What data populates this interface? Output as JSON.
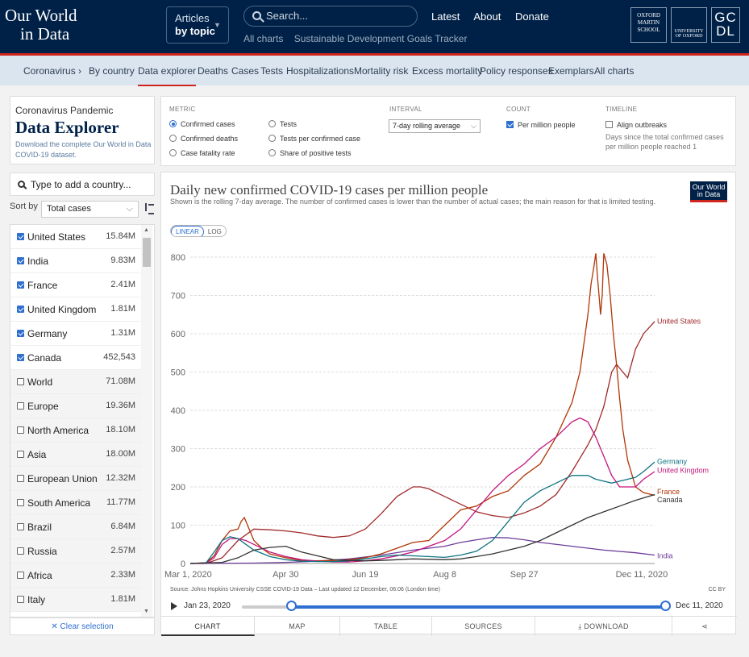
{
  "logo": {
    "line1": "Our World",
    "line2": "in Data"
  },
  "articles": {
    "line1": "Articles",
    "line2": "by topic"
  },
  "search": {
    "placeholder": "Search..."
  },
  "sublinks": [
    "All charts",
    "Sustainable Development Goals Tracker"
  ],
  "mainnav": [
    "Latest",
    "About",
    "Donate"
  ],
  "partners": {
    "oxford_martin": [
      "OXFORD",
      "MARTIN",
      "SCHOOL"
    ],
    "oxford": "UNIVERSITY OF OXFORD",
    "gcdl": [
      "GC",
      "DL"
    ]
  },
  "subnav": [
    "Coronavirus ›",
    "By country",
    "Data explorer",
    "Deaths",
    "Cases",
    "Tests",
    "Hospitalizations",
    "Mortality risk",
    "Excess mortality",
    "Policy responses",
    "Exemplars",
    "All charts"
  ],
  "explorer": {
    "kicker": "Coronavirus Pandemic",
    "title": "Data Explorer",
    "desc": "Download the complete Our World in Data COVID-19 dataset."
  },
  "add_country": "Type to add a country...",
  "sort": {
    "label": "Sort by",
    "value": "Total cases"
  },
  "countries": [
    {
      "name": "United States",
      "value": "15.84M",
      "checked": true
    },
    {
      "name": "India",
      "value": "9.83M",
      "checked": true
    },
    {
      "name": "France",
      "value": "2.41M",
      "checked": true
    },
    {
      "name": "United Kingdom",
      "value": "1.81M",
      "checked": true
    },
    {
      "name": "Germany",
      "value": "1.31M",
      "checked": true
    },
    {
      "name": "Canada",
      "value": "452,543",
      "checked": true
    },
    {
      "name": "World",
      "value": "71.08M",
      "checked": false
    },
    {
      "name": "Europe",
      "value": "19.36M",
      "checked": false
    },
    {
      "name": "North America",
      "value": "18.10M",
      "checked": false
    },
    {
      "name": "Asia",
      "value": "18.00M",
      "checked": false
    },
    {
      "name": "European Union",
      "value": "12.32M",
      "checked": false
    },
    {
      "name": "South America",
      "value": "11.77M",
      "checked": false
    },
    {
      "name": "Brazil",
      "value": "6.84M",
      "checked": false
    },
    {
      "name": "Russia",
      "value": "2.57M",
      "checked": false
    },
    {
      "name": "Africa",
      "value": "2.33M",
      "checked": false
    },
    {
      "name": "Italy",
      "value": "1.81M",
      "checked": false
    }
  ],
  "clear_selection": "✕ Clear selection",
  "controls": {
    "metric_label": "METRIC",
    "metrics": [
      {
        "label": "Confirmed cases",
        "selected": true
      },
      {
        "label": "Confirmed deaths",
        "selected": false
      },
      {
        "label": "Case fatality rate",
        "selected": false
      },
      {
        "label": "Tests",
        "selected": false
      },
      {
        "label": "Tests per confirmed case",
        "selected": false
      },
      {
        "label": "Share of positive tests",
        "selected": false
      }
    ],
    "interval_label": "INTERVAL",
    "interval_value": "7-day rolling average",
    "count_label": "COUNT",
    "count_option": "Per million people",
    "timeline_label": "TIMELINE",
    "timeline_option": "Align outbreaks",
    "timeline_note": "Days since the total confirmed cases per million people reached 1"
  },
  "chart": {
    "title": "Daily new confirmed COVID-19 cases per million people",
    "subtitle": "Shown is the rolling 7-day average. The number of confirmed cases is lower than the number of actual cases; the main reason for that is limited testing.",
    "badge_line1": "Our World",
    "badge_line2": "in Data",
    "scale_linear": "LINEAR",
    "scale_log": "LOG",
    "source": "Source: Johns Hopkins University CSSE COVID-19 Data – Last updated 12 December, 06:06 (London time)",
    "license": "CC BY"
  },
  "timeline": {
    "start": "Jan 23, 2020",
    "end": "Dec 11, 2020"
  },
  "tabs": [
    "CHART",
    "MAP",
    "TABLE",
    "SOURCES",
    "DOWNLOAD"
  ],
  "chart_data": {
    "type": "line",
    "title": "Daily new confirmed COVID-19 cases per million people",
    "ylim": [
      0,
      800
    ],
    "yticks": [
      0,
      100,
      200,
      300,
      400,
      500,
      600,
      700,
      800
    ],
    "xticks": [
      {
        "label": "Mar 1, 2020",
        "d": 0
      },
      {
        "label": "Apr 30",
        "d": 60
      },
      {
        "label": "Jun 19",
        "d": 110
      },
      {
        "label": "Aug 8",
        "d": 160
      },
      {
        "label": "Sep 27",
        "d": 210
      },
      {
        "label": "Dec 11, 2020",
        "d": 285
      }
    ],
    "x_days_since": "Mar 1, 2020",
    "series": [
      {
        "name": "United States",
        "color": "#a02a2a",
        "points": [
          [
            0,
            0
          ],
          [
            10,
            0
          ],
          [
            20,
            15
          ],
          [
            30,
            60
          ],
          [
            40,
            90
          ],
          [
            50,
            88
          ],
          [
            60,
            85
          ],
          [
            70,
            80
          ],
          [
            80,
            72
          ],
          [
            90,
            68
          ],
          [
            100,
            72
          ],
          [
            110,
            90
          ],
          [
            120,
            130
          ],
          [
            130,
            175
          ],
          [
            140,
            200
          ],
          [
            145,
            200
          ],
          [
            150,
            195
          ],
          [
            160,
            175
          ],
          [
            170,
            155
          ],
          [
            180,
            135
          ],
          [
            190,
            125
          ],
          [
            200,
            120
          ],
          [
            210,
            132
          ],
          [
            220,
            150
          ],
          [
            230,
            180
          ],
          [
            240,
            240
          ],
          [
            250,
            310
          ],
          [
            255,
            350
          ],
          [
            260,
            410
          ],
          [
            265,
            500
          ],
          [
            268,
            520
          ],
          [
            272,
            500
          ],
          [
            275,
            485
          ],
          [
            280,
            560
          ],
          [
            285,
            600
          ],
          [
            292,
            632
          ]
        ],
        "label_y": 635
      },
      {
        "name": "India",
        "color": "#6c3d9a",
        "points": [
          [
            0,
            0
          ],
          [
            40,
            1
          ],
          [
            60,
            3
          ],
          [
            80,
            6
          ],
          [
            100,
            12
          ],
          [
            120,
            22
          ],
          [
            140,
            35
          ],
          [
            160,
            45
          ],
          [
            170,
            55
          ],
          [
            180,
            62
          ],
          [
            190,
            68
          ],
          [
            200,
            67
          ],
          [
            210,
            62
          ],
          [
            220,
            55
          ],
          [
            240,
            45
          ],
          [
            260,
            35
          ],
          [
            280,
            28
          ],
          [
            292,
            22
          ]
        ],
        "label_y": 22
      },
      {
        "name": "France",
        "color": "#b13507",
        "points": [
          [
            0,
            0
          ],
          [
            10,
            2
          ],
          [
            15,
            20
          ],
          [
            20,
            60
          ],
          [
            25,
            85
          ],
          [
            30,
            90
          ],
          [
            32,
            110
          ],
          [
            34,
            120
          ],
          [
            36,
            100
          ],
          [
            38,
            80
          ],
          [
            40,
            60
          ],
          [
            45,
            40
          ],
          [
            50,
            25
          ],
          [
            60,
            15
          ],
          [
            70,
            8
          ],
          [
            80,
            7
          ],
          [
            90,
            8
          ],
          [
            100,
            10
          ],
          [
            110,
            15
          ],
          [
            120,
            25
          ],
          [
            130,
            40
          ],
          [
            140,
            55
          ],
          [
            150,
            60
          ],
          [
            160,
            100
          ],
          [
            170,
            140
          ],
          [
            180,
            150
          ],
          [
            190,
            175
          ],
          [
            200,
            190
          ],
          [
            205,
            210
          ],
          [
            210,
            230
          ],
          [
            220,
            260
          ],
          [
            230,
            330
          ],
          [
            240,
            420
          ],
          [
            245,
            500
          ],
          [
            250,
            650
          ],
          [
            252,
            730
          ],
          [
            254,
            780
          ],
          [
            255,
            810
          ],
          [
            256,
            750
          ],
          [
            257,
            700
          ],
          [
            258,
            650
          ],
          [
            259,
            700
          ],
          [
            260,
            810
          ],
          [
            262,
            780
          ],
          [
            264,
            700
          ],
          [
            266,
            600
          ],
          [
            268,
            520
          ],
          [
            270,
            430
          ],
          [
            272,
            350
          ],
          [
            275,
            270
          ],
          [
            280,
            200
          ],
          [
            285,
            185
          ],
          [
            292,
            178
          ]
        ],
        "label_y": 190
      },
      {
        "name": "United Kingdom",
        "color": "#c4157e",
        "points": [
          [
            0,
            0
          ],
          [
            10,
            1
          ],
          [
            15,
            15
          ],
          [
            20,
            50
          ],
          [
            25,
            65
          ],
          [
            30,
            65
          ],
          [
            35,
            60
          ],
          [
            40,
            50
          ],
          [
            50,
            30
          ],
          [
            60,
            18
          ],
          [
            70,
            10
          ],
          [
            80,
            6
          ],
          [
            90,
            4
          ],
          [
            100,
            4
          ],
          [
            110,
            7
          ],
          [
            120,
            12
          ],
          [
            130,
            20
          ],
          [
            140,
            30
          ],
          [
            150,
            45
          ],
          [
            160,
            60
          ],
          [
            170,
            90
          ],
          [
            180,
            140
          ],
          [
            190,
            190
          ],
          [
            200,
            230
          ],
          [
            210,
            260
          ],
          [
            220,
            300
          ],
          [
            230,
            330
          ],
          [
            240,
            370
          ],
          [
            245,
            380
          ],
          [
            250,
            370
          ],
          [
            255,
            330
          ],
          [
            260,
            280
          ],
          [
            265,
            230
          ],
          [
            270,
            200
          ],
          [
            280,
            200
          ],
          [
            285,
            220
          ],
          [
            292,
            240
          ]
        ],
        "label_y": 245
      },
      {
        "name": "Germany",
        "color": "#0e7480",
        "points": [
          [
            0,
            0
          ],
          [
            10,
            2
          ],
          [
            15,
            30
          ],
          [
            20,
            60
          ],
          [
            25,
            70
          ],
          [
            30,
            65
          ],
          [
            35,
            50
          ],
          [
            40,
            35
          ],
          [
            50,
            18
          ],
          [
            60,
            10
          ],
          [
            70,
            6
          ],
          [
            80,
            5
          ],
          [
            90,
            5
          ],
          [
            100,
            7
          ],
          [
            110,
            12
          ],
          [
            120,
            18
          ],
          [
            130,
            22
          ],
          [
            140,
            20
          ],
          [
            150,
            18
          ],
          [
            160,
            16
          ],
          [
            170,
            22
          ],
          [
            180,
            32
          ],
          [
            190,
            60
          ],
          [
            200,
            110
          ],
          [
            210,
            160
          ],
          [
            220,
            190
          ],
          [
            230,
            210
          ],
          [
            240,
            230
          ],
          [
            250,
            230
          ],
          [
            255,
            220
          ],
          [
            260,
            215
          ],
          [
            265,
            210
          ],
          [
            270,
            215
          ],
          [
            280,
            225
          ],
          [
            285,
            240
          ],
          [
            292,
            265
          ]
        ],
        "label_y": 268
      },
      {
        "name": "Canada",
        "color": "#333333",
        "points": [
          [
            0,
            0
          ],
          [
            20,
            3
          ],
          [
            30,
            15
          ],
          [
            40,
            35
          ],
          [
            50,
            42
          ],
          [
            60,
            45
          ],
          [
            70,
            30
          ],
          [
            80,
            20
          ],
          [
            90,
            10
          ],
          [
            100,
            8
          ],
          [
            110,
            7
          ],
          [
            120,
            8
          ],
          [
            130,
            10
          ],
          [
            140,
            12
          ],
          [
            150,
            11
          ],
          [
            160,
            10
          ],
          [
            170,
            12
          ],
          [
            180,
            18
          ],
          [
            190,
            25
          ],
          [
            200,
            35
          ],
          [
            210,
            45
          ],
          [
            220,
            60
          ],
          [
            230,
            80
          ],
          [
            240,
            100
          ],
          [
            250,
            120
          ],
          [
            260,
            135
          ],
          [
            270,
            150
          ],
          [
            280,
            165
          ],
          [
            292,
            180
          ]
        ],
        "label_y": 168
      }
    ]
  }
}
